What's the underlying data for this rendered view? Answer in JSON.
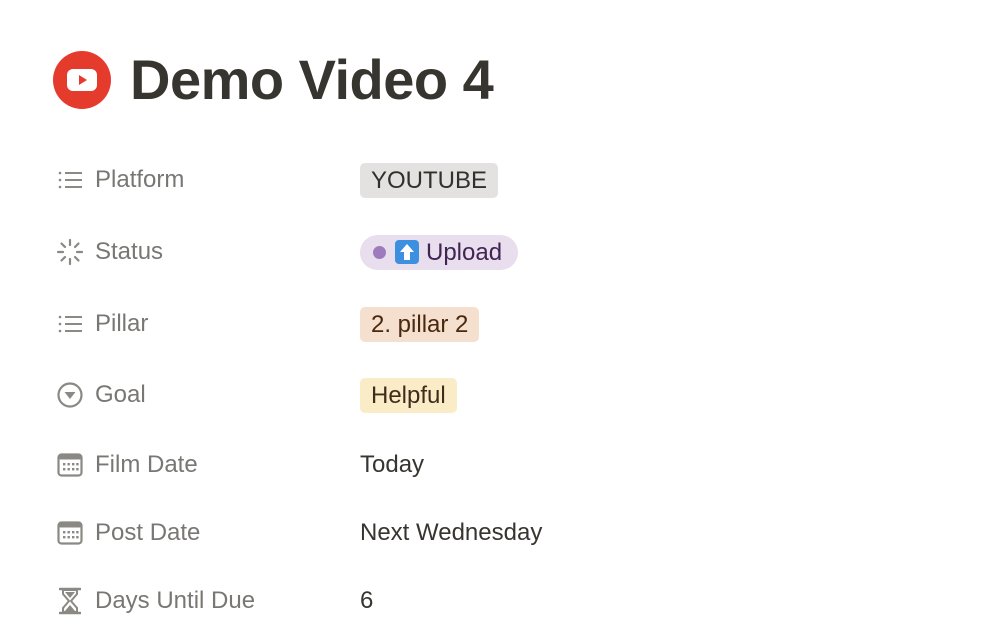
{
  "page": {
    "title": "Demo Video 4",
    "icon": "youtube-icon",
    "icon_color": "#e53b2c"
  },
  "properties": [
    {
      "name": "Platform",
      "icon": "list-icon",
      "value": "YOUTUBE",
      "type": "select",
      "tag_color": "#e3e2e0"
    },
    {
      "name": "Status",
      "icon": "status-loading-icon",
      "value": "Upload",
      "value_emoji": "up-arrow-emoji",
      "type": "status",
      "tag_color": "#e8deee",
      "dot_color": "#9d7bbd"
    },
    {
      "name": "Pillar",
      "icon": "list-icon",
      "value": "2. pillar 2",
      "type": "select",
      "tag_color": "#f5dfcf"
    },
    {
      "name": "Goal",
      "icon": "chevron-circle-icon",
      "value": "Helpful",
      "type": "select",
      "tag_color": "#fbecc8"
    },
    {
      "name": "Film Date",
      "icon": "calendar-icon",
      "value": "Today",
      "type": "date"
    },
    {
      "name": "Post Date",
      "icon": "calendar-icon",
      "value": "Next Wednesday",
      "type": "date"
    },
    {
      "name": "Days Until Due",
      "icon": "hourglass-icon",
      "value": "6",
      "type": "formula"
    }
  ]
}
